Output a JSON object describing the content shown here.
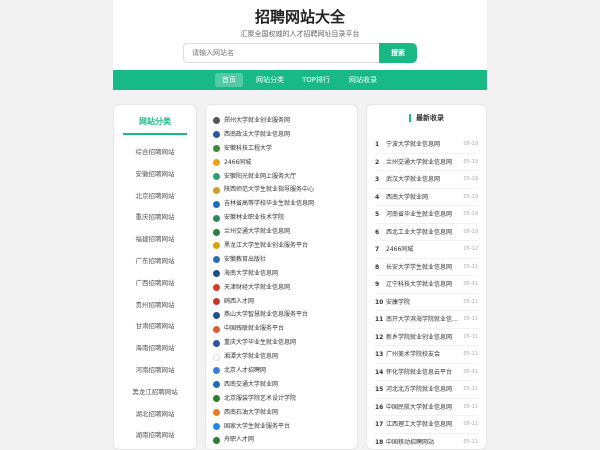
{
  "header": {
    "title": "招聘网站大全",
    "subtitle": "汇聚全国权威的人才招聘网址目录平台",
    "search_placeholder": "请输入网站名",
    "search_button": "搜索"
  },
  "nav": {
    "items": [
      "首页",
      "网站分类",
      "TOP排行",
      "网站收录"
    ],
    "active_index": 0
  },
  "left_panel": {
    "title": "网站分类",
    "items": [
      "综合招聘网站",
      "安徽招聘网站",
      "北京招聘网站",
      "重庆招聘网站",
      "福建招聘网站",
      "广东招聘网站",
      "广西招聘网站",
      "贵州招聘网站",
      "甘肃招聘网站",
      "海南招聘网站",
      "河南招聘网站",
      "黑龙江招聘网站",
      "湖北招聘网站",
      "湖南招聘网站"
    ]
  },
  "mid_panel": {
    "items": [
      {
        "name": "郑州大学就业创业服务网",
        "icon": "university-seal-icon",
        "color": "#555555"
      },
      {
        "name": "西南政法大学就业信息网",
        "icon": "university-seal-icon",
        "color": "#2a56a8"
      },
      {
        "name": "安徽科技工程大学",
        "icon": "university-seal-icon",
        "color": "#3a8a3a"
      },
      {
        "name": "2466同城",
        "icon": "site-logo-icon",
        "color": "#e8a317"
      },
      {
        "name": "安徽阳光就业网上服务大厅",
        "icon": "sun-logo-icon",
        "color": "#29a36a"
      },
      {
        "name": "陕西师范大学生就业指导服务中心",
        "icon": "university-seal-icon",
        "color": "#c9a227"
      },
      {
        "name": "吉林省高等学校毕业生就业信息网",
        "icon": "university-seal-icon",
        "color": "#1f6fb2"
      },
      {
        "name": "安徽林业职业技术学院",
        "icon": "university-seal-icon",
        "color": "#2e8b57"
      },
      {
        "name": "兰州交通大学就业信息网",
        "icon": "university-seal-icon",
        "color": "#2f7d3b"
      },
      {
        "name": "黑龙江大学生就业创业服务平台",
        "icon": "site-logo-icon",
        "color": "#d9a400"
      },
      {
        "name": "安徽教育出版社",
        "icon": "university-seal-icon",
        "color": "#2a6db5"
      },
      {
        "name": "海南大学就业信息网",
        "icon": "university-seal-icon",
        "color": "#1a4f8a"
      },
      {
        "name": "天津财经大学就业信息网",
        "icon": "site-logo-icon",
        "color": "#d83b2b"
      },
      {
        "name": "鸥西人才网",
        "icon": "site-logo-icon",
        "color": "#c0392b"
      },
      {
        "name": "燕山大学智慧就业信息服务平台",
        "icon": "university-seal-icon",
        "color": "#1f4e9a"
      },
      {
        "name": "中国残联就业服务平台",
        "icon": "site-logo-icon",
        "color": "#e25b2e"
      },
      {
        "name": "重庆大学毕业生就业信息网",
        "icon": "university-seal-icon",
        "color": "#2a56a8"
      },
      {
        "name": "湘潭大学就业信息网",
        "icon": "university-seal-icon",
        "color": "#ffffff"
      },
      {
        "name": "北京人才招聘网",
        "icon": "site-logo-icon",
        "color": "#3b7dd8"
      },
      {
        "name": "西南交通大学就业网",
        "icon": "university-seal-icon",
        "color": "#1f6fb2"
      },
      {
        "name": "北京服装学院艺术设计学院",
        "icon": "university-seal-icon",
        "color": "#2e7d32"
      },
      {
        "name": "西南石油大学就业网",
        "icon": "site-logo-icon",
        "color": "#e67e22"
      },
      {
        "name": "国家大学生就业服务平台",
        "icon": "site-logo-icon",
        "color": "#1e88e5"
      },
      {
        "name": "舟职人才网",
        "icon": "site-logo-icon",
        "color": "#2e7d32"
      }
    ]
  },
  "right_panel": {
    "title": "最新收录",
    "items": [
      {
        "rank": "1",
        "name": "宁波大学就业信息网",
        "date": "05-19"
      },
      {
        "rank": "2",
        "name": "兰州交通大学就业信息网",
        "date": "05-19"
      },
      {
        "rank": "3",
        "name": "武汉大学就业信息网",
        "date": "05-19"
      },
      {
        "rank": "4",
        "name": "西南大学就业网",
        "date": "05-19"
      },
      {
        "rank": "5",
        "name": "河南省毕业生就业信息网",
        "date": "05-19"
      },
      {
        "rank": "6",
        "name": "西北工业大学就业信息网",
        "date": "05-19"
      },
      {
        "rank": "7",
        "name": "2466同城",
        "date": "05-12"
      },
      {
        "rank": "8",
        "name": "长安大学学生就业信息网",
        "date": "05-11"
      },
      {
        "rank": "9",
        "name": "辽宁科技大学就业信息网",
        "date": "05-11"
      },
      {
        "rank": "10",
        "name": "安康学院",
        "date": "05-11"
      },
      {
        "rank": "11",
        "name": "南开大学滨海学院就业信息网",
        "date": "05-11"
      },
      {
        "rank": "12",
        "name": "新乡学院就业创业信息网",
        "date": "05-11"
      },
      {
        "rank": "13",
        "name": "广州美术学院校友会",
        "date": "05-11"
      },
      {
        "rank": "14",
        "name": "怀化学院就业信息云平台",
        "date": "05-11"
      },
      {
        "rank": "15",
        "name": "河北北方学院就业信息网",
        "date": "05-11"
      },
      {
        "rank": "16",
        "name": "中国民航大学就业信息网",
        "date": "05-11"
      },
      {
        "rank": "17",
        "name": "江西理工大学就业信息网",
        "date": "05-11"
      },
      {
        "rank": "18",
        "name": "中国移动招聘网站",
        "date": "05-11"
      }
    ]
  }
}
